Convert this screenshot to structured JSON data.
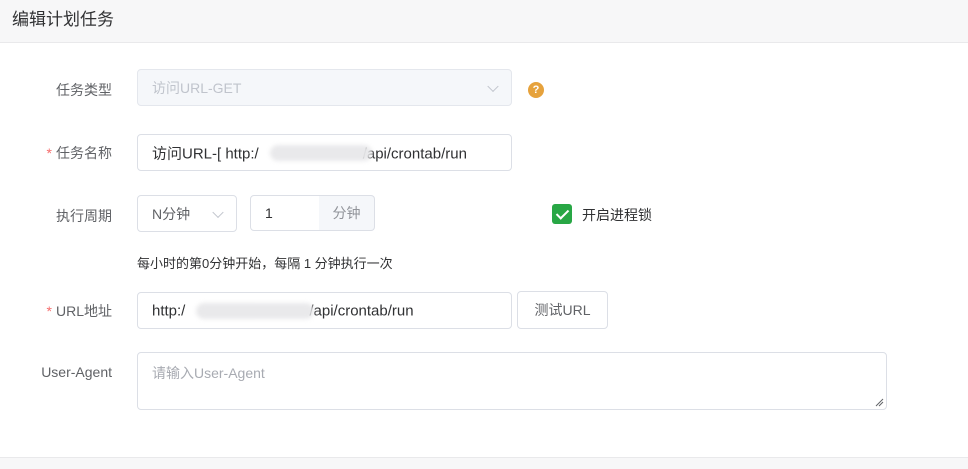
{
  "header": {
    "title": "编辑计划任务"
  },
  "form": {
    "task_type": {
      "label": "任务类型",
      "value": "访问URL-GET",
      "help": "?"
    },
    "task_name": {
      "required_mark": "*",
      "label": "任务名称",
      "value_prefix": "访问URL-[ http:/",
      "value_suffix": "/api/crontab/run"
    },
    "period": {
      "label": "执行周期",
      "unit_select": "N分钟",
      "number": "1",
      "number_unit": "分钟",
      "lock_checked": true,
      "lock_label": "开启进程锁",
      "hint": "每小时的第0分钟开始，每隔 1 分钟执行一次"
    },
    "url": {
      "required_mark": "*",
      "label": "URL地址",
      "value_prefix": "http:/",
      "value_suffix": "/api/crontab/run",
      "test_button": "测试URL"
    },
    "user_agent": {
      "label": "User-Agent",
      "placeholder": "请输入User-Agent"
    }
  },
  "colors": {
    "checkbox": "#28a745",
    "help": "#e6a23c",
    "required": "#f56c6c"
  }
}
